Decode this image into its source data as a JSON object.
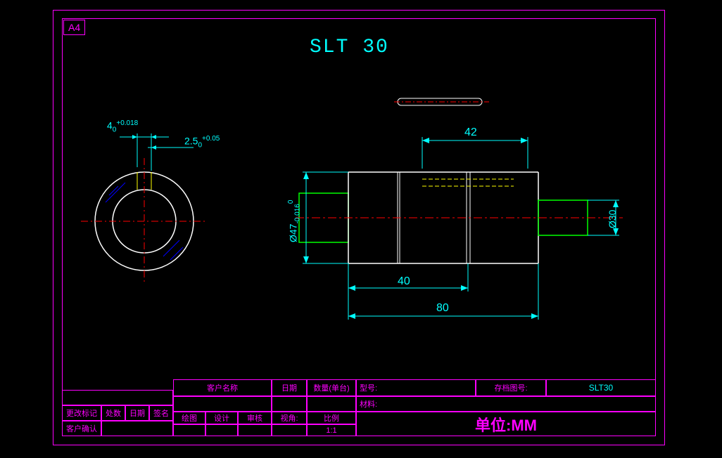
{
  "page_size": "A4",
  "title": "SLT 30",
  "dimensions": {
    "dim_4": "4",
    "dim_4_tol_upper": "+0.018",
    "dim_4_tol_lower": "0",
    "dim_2_5": "2.5",
    "dim_2_5_tol_upper": "+0.05",
    "dim_2_5_tol_lower": "0",
    "dim_42": "42",
    "dim_40": "40",
    "dim_80": "80",
    "dia_47": "Ø47",
    "dia_47_tol_upper": "0",
    "dia_47_tol_lower": "-0.016",
    "dia_30": "Ø30"
  },
  "title_block": {
    "customer_label": "客户名称",
    "date_label": "日期",
    "qty_label": "数量(单台)",
    "model_label": "型号:",
    "archive_label": "存档图号:",
    "archive_value": "SLT30",
    "material_label": "材料:",
    "draw_label": "绘图",
    "design_label": "设计",
    "review_label": "审核",
    "angle_label": "视角:",
    "scale_label": "比例",
    "scale_value": "1:1",
    "unit_label": "单位:",
    "unit_value": "MM",
    "change_mark": "更改标记",
    "location": "处数",
    "date2": "日期",
    "sign": "签名",
    "customer_confirm": "客户确认"
  }
}
